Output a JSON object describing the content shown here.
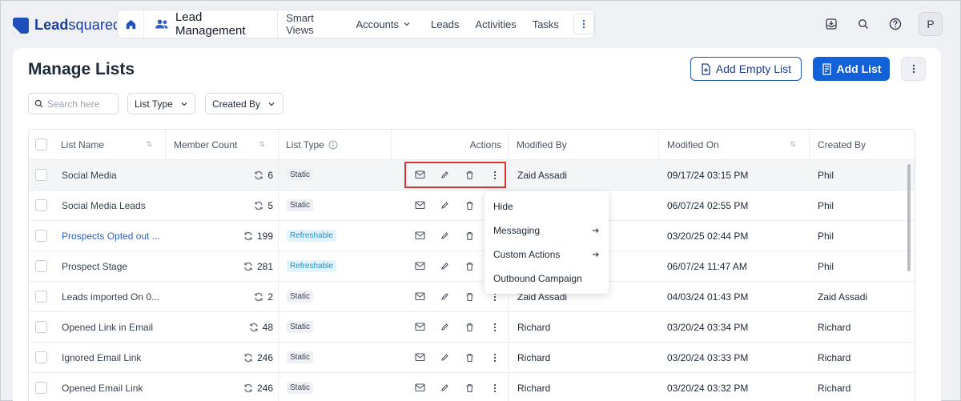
{
  "brand": {
    "name_part1": "Lead",
    "name_part2": "squared"
  },
  "nav": {
    "module": "Lead Management",
    "items": [
      {
        "label": "Smart Views"
      },
      {
        "label": "Accounts",
        "has_dropdown": true
      },
      {
        "label": "Leads"
      },
      {
        "label": "Activities"
      },
      {
        "label": "Tasks"
      }
    ]
  },
  "user": {
    "initial": "P"
  },
  "page": {
    "title": "Manage Lists",
    "add_empty_list": "Add Empty List",
    "add_list": "Add List"
  },
  "filters": {
    "search_placeholder": "Search here",
    "list_type": "List Type",
    "created_by": "Created By"
  },
  "table": {
    "headers": {
      "list_name": "List Name",
      "member_count": "Member Count",
      "list_type": "List Type",
      "actions": "Actions",
      "modified_by": "Modified By",
      "modified_on": "Modified On",
      "created_by": "Created By"
    },
    "rows": [
      {
        "name": "Social Media",
        "count": "6",
        "type": "Static",
        "modified_by": "Zaid Assadi",
        "modified_on": "09/17/24 03:15 PM",
        "created_by": "Phil"
      },
      {
        "name": "Social Media Leads",
        "count": "5",
        "type": "Static",
        "modified_by": "",
        "modified_on": "06/07/24 02:55 PM",
        "created_by": "Phil"
      },
      {
        "name": "Prospects Opted out ...",
        "count": "199",
        "type": "Refreshable",
        "modified_by": "",
        "modified_on": "03/20/25 02:44 PM",
        "created_by": "Phil"
      },
      {
        "name": "Prospect Stage",
        "count": "281",
        "type": "Refreshable",
        "modified_by": "",
        "modified_on": "06/07/24 11:47 AM",
        "created_by": "Phil"
      },
      {
        "name": "Leads imported On 0...",
        "count": "2",
        "type": "Static",
        "modified_by": "Zaid Assadi",
        "modified_on": "04/03/24 01:43 PM",
        "created_by": "Zaid Assadi"
      },
      {
        "name": "Opened Link in Email",
        "count": "48",
        "type": "Static",
        "modified_by": "Richard",
        "modified_on": "03/20/24 03:34 PM",
        "created_by": "Richard"
      },
      {
        "name": "Ignored Email Link",
        "count": "246",
        "type": "Static",
        "modified_by": "Richard",
        "modified_on": "03/20/24 03:33 PM",
        "created_by": "Richard"
      },
      {
        "name": "Opened Email Link",
        "count": "246",
        "type": "Static",
        "modified_by": "Richard",
        "modified_on": "03/20/24 03:32 PM",
        "created_by": "Richard"
      }
    ]
  },
  "context_menu": {
    "items": [
      {
        "label": "Hide",
        "submenu": false
      },
      {
        "label": "Messaging",
        "submenu": true
      },
      {
        "label": "Custom Actions",
        "submenu": true
      },
      {
        "label": "Outbound Campaign",
        "submenu": false
      }
    ]
  },
  "colors": {
    "primary": "#1261d8",
    "brand": "#1a3f99",
    "refreshable": "#2a8fc2",
    "highlight": "#d93434"
  }
}
